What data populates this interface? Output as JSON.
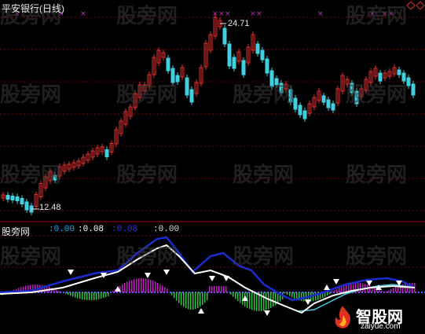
{
  "chart": {
    "title": "平安银行(日线)",
    "high_label": "24.71",
    "low_label": "12.48"
  },
  "indicator": {
    "name": "股旁网",
    "values": [
      ":0.00",
      ":0.08",
      ":0.08",
      ":0.00"
    ]
  },
  "watermark": "股旁网",
  "logo": {
    "text": "智股网",
    "url": "zaiyue.com"
  },
  "colors": {
    "up": "#e03030",
    "down": "#40d0e0",
    "grid": "#7a0000",
    "blue_line": "#1a2cd0",
    "white_line": "#ffffff",
    "magenta_bar": "#c020c0",
    "green_bar": "#30c040"
  },
  "chart_data": [
    {
      "type": "candlestick",
      "title": "平安银行(日线)",
      "high": 24.71,
      "low": 12.48
    },
    {
      "type": "bar",
      "title": "股旁网",
      "values": [
        0.0,
        0.08,
        0.08,
        0.0
      ]
    }
  ]
}
